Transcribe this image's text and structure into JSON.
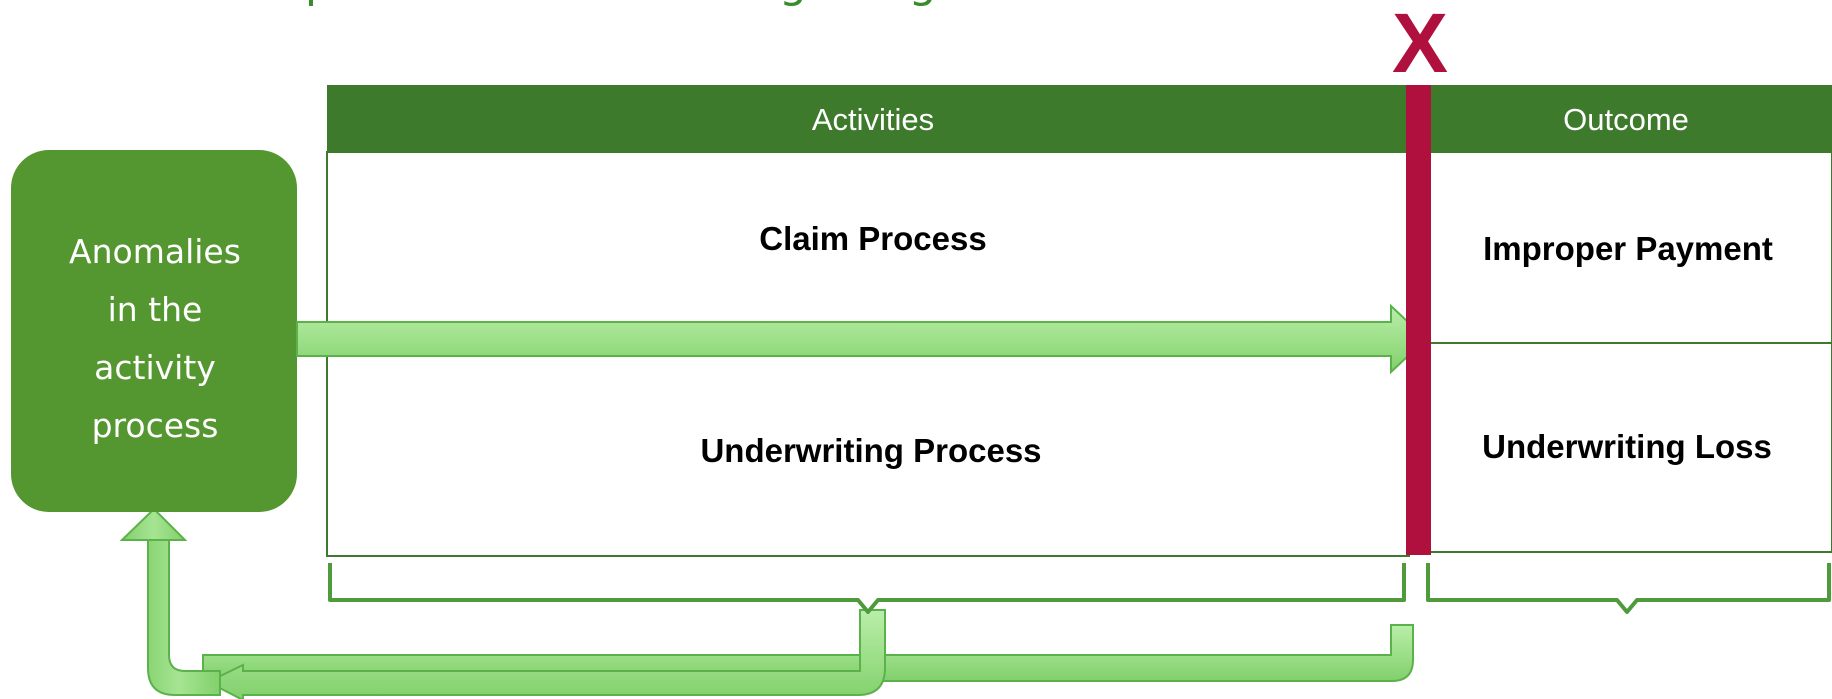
{
  "caption": "possible. We call this getting “Left of X.”",
  "x_mark": "X",
  "anomalies_box": {
    "lines": [
      "Anomalies",
      "in the",
      "activity",
      "process"
    ]
  },
  "table": {
    "activities_heading": "Activities",
    "outcome_heading": "Outcome",
    "activities": [
      "Claim Process",
      "Underwriting Process"
    ],
    "outcomes": [
      "Improper Payment",
      "Underwriting Loss"
    ]
  },
  "colors": {
    "header_green": "#3d7a2c",
    "box_green": "#54962f",
    "arrow_fill": "#9ee08a",
    "arrow_stroke": "#5cb24a",
    "bracket": "#4f9a3a",
    "x_line": "#b0103e"
  }
}
